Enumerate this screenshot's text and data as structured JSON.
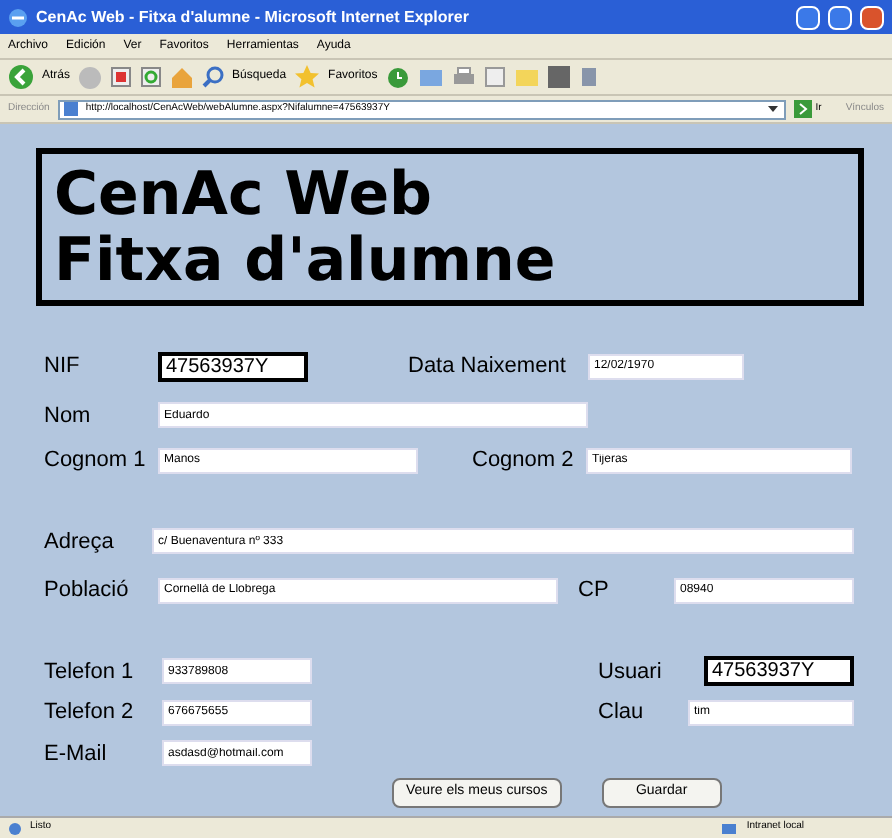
{
  "window": {
    "title": "CenAc Web - Fitxa d'alumne - Microsoft Internet Explorer"
  },
  "menu": [
    "Archivo",
    "Edición",
    "Ver",
    "Favoritos",
    "Herramientas",
    "Ayuda"
  ],
  "toolbar": {
    "back": "Atrás",
    "search": "Búsqueda",
    "favorites": "Favoritos"
  },
  "address_bar": {
    "label": "Dirección",
    "url": "http://localhost/CenAcWeb/webAlumne.aspx?Nifalumne=47563937Y",
    "go": "Ir",
    "links": "Vínculos"
  },
  "header": {
    "lines": [
      "CenAc Web",
      "Fitxa d'alumne"
    ]
  },
  "form": {
    "rows": [
      [
        {
          "label": "NIF",
          "value": "47563937Y",
          "emphasized": true
        },
        {
          "label": "Data Naixement",
          "value": "12/02/1970",
          "emphasized": false
        }
      ],
      [
        {
          "label": "Nom",
          "value": "Eduardo",
          "emphasized": false
        }
      ],
      [
        {
          "label": "Cognom 1",
          "value": "Manos",
          "emphasized": false
        },
        {
          "label": "Cognom 2",
          "value": "Tijeras",
          "emphasized": false
        }
      ],
      [
        {
          "label": "Adreça",
          "value": "c/ Buenaventura nº 333",
          "emphasized": false
        }
      ],
      [
        {
          "label": "Població",
          "value": "Cornellà de Llobrega",
          "emphasized": false
        },
        {
          "label": "CP",
          "value": "08940",
          "emphasized": false
        }
      ],
      [
        {
          "label": "Telefon 1",
          "value": "933789808",
          "emphasized": false
        },
        {
          "label": "Usuari",
          "value": "47563937Y",
          "emphasized": true
        }
      ],
      [
        {
          "label": "Telefon 2",
          "value": "676675655",
          "emphasized": false
        },
        {
          "label": "Clau",
          "value": "tim",
          "emphasized": false
        }
      ],
      [
        {
          "label": "E-Mail",
          "value": "asdasd@hotmail.com",
          "emphasized": false
        }
      ]
    ],
    "buttons": [
      "Veure els meus cursos",
      "Guardar"
    ]
  },
  "status_bar": {
    "text": "Listo",
    "zone": "Intranet local"
  }
}
